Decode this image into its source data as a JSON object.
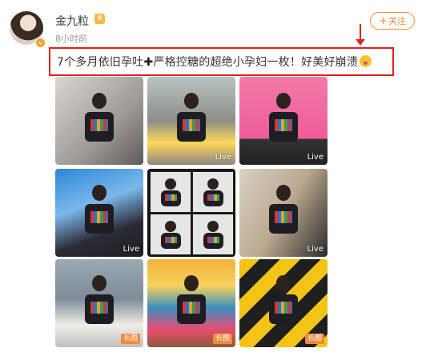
{
  "user": {
    "name": "金九粒",
    "timestamp": "8小时前",
    "avatar_icon": "user-avatar",
    "vip_icon": "crown-icon",
    "verified_icon": "verified-badge-icon"
  },
  "follow_button": {
    "label": "关注",
    "icon": "plus-icon",
    "color": "#f28b3c"
  },
  "post": {
    "text_before_plus": "7个多月依旧孕吐",
    "plus_glyph": "✚",
    "text_after_plus": "严格控糖的超绝小孕妇一枚！好美好崩溃",
    "emoji": "tongue-face-emoji",
    "highlight_color": "#e02020"
  },
  "images": [
    {
      "badge": ""
    },
    {
      "badge": "Live"
    },
    {
      "badge": "Live"
    },
    {
      "badge": "Live"
    },
    {
      "badge": ""
    },
    {
      "badge": "Live"
    },
    {
      "badge": "长图"
    },
    {
      "badge": "长图"
    },
    {
      "badge": "长图"
    }
  ]
}
